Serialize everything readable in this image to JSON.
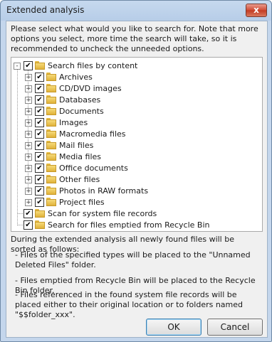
{
  "window": {
    "title": "Extended analysis",
    "close_glyph": "x"
  },
  "intro": "Please select what would you like to search for. Note that more options you select, more time the search will take, so it is recommended to uncheck the unneeded options.",
  "tree": {
    "root": {
      "label": "Search files by content",
      "checked": true,
      "expanded": true
    },
    "children": [
      {
        "label": "Archives",
        "checked": true
      },
      {
        "label": "CD/DVD images",
        "checked": true
      },
      {
        "label": "Databases",
        "checked": true
      },
      {
        "label": "Documents",
        "checked": true
      },
      {
        "label": "Images",
        "checked": true
      },
      {
        "label": "Macromedia files",
        "checked": true
      },
      {
        "label": "Mail files",
        "checked": true
      },
      {
        "label": "Media files",
        "checked": true
      },
      {
        "label": "Office documents",
        "checked": true
      },
      {
        "label": "Other files",
        "checked": true
      },
      {
        "label": "Photos in RAW formats",
        "checked": true
      },
      {
        "label": "Project files",
        "checked": true
      }
    ],
    "siblings": [
      {
        "label": "Scan for system file records",
        "checked": true
      },
      {
        "label": "Search for files emptied from Recycle Bin",
        "checked": true
      }
    ]
  },
  "notes": {
    "heading": "During the extended analysis all newly found files will be sorted as follows:",
    "items": [
      "- Files of the specified types will be placed to the \"Unnamed Deleted Files\" folder.",
      "- Files emptied from Recycle Bin will be placed to the Recycle Bin folder.",
      "- Files referenced in the found system file records will be placed either to their original location or to folders named \"$$folder_xxx\"."
    ]
  },
  "buttons": {
    "ok": "OK",
    "cancel": "Cancel"
  },
  "colors": {
    "titlebar": "#b7cde8",
    "close_button": "#c23a22",
    "folder": "#e0b23a"
  }
}
